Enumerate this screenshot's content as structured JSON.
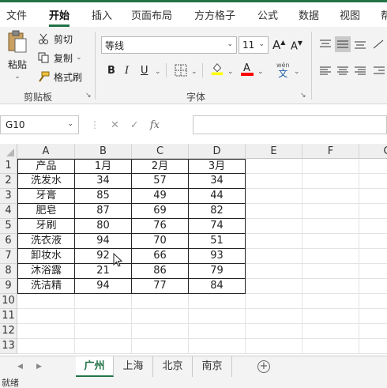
{
  "ribbon_tabs": [
    "文件",
    "开始",
    "插入",
    "页面布局",
    "方方格子",
    "公式",
    "数据",
    "视图",
    "帮"
  ],
  "clipboard": {
    "paste": "粘贴",
    "cut": "剪切",
    "copy": "复制",
    "format_painter": "格式刷",
    "group_label": "剪贴板"
  },
  "font": {
    "name": "等线",
    "size": "11",
    "grow": "A",
    "shrink": "A",
    "bold": "B",
    "italic": "I",
    "underline": "U",
    "pinyin": "wén",
    "pinyin_sub": "文",
    "group_label": "字体",
    "fill_color": "#ffff00",
    "font_color": "#ff0000"
  },
  "name_box": "G10",
  "fx_label": "fx",
  "formula": "",
  "columns": [
    "A",
    "B",
    "C",
    "D",
    "E",
    "F",
    "G"
  ],
  "rows": [
    "1",
    "2",
    "3",
    "4",
    "5",
    "6",
    "7",
    "8",
    "9",
    "10",
    "11",
    "12",
    "13"
  ],
  "table": {
    "header": [
      "产品",
      "1月",
      "2月",
      "3月"
    ],
    "body": [
      [
        "洗发水",
        "34",
        "57",
        "34"
      ],
      [
        "牙膏",
        "85",
        "49",
        "44"
      ],
      [
        "肥皂",
        "87",
        "69",
        "82"
      ],
      [
        "牙刷",
        "80",
        "76",
        "74"
      ],
      [
        "洗衣液",
        "94",
        "70",
        "51"
      ],
      [
        "卸妆水",
        "92",
        "66",
        "93"
      ],
      [
        "沐浴露",
        "21",
        "86",
        "79"
      ],
      [
        "洗洁精",
        "94",
        "77",
        "84"
      ]
    ]
  },
  "sheets": [
    "广州",
    "上海",
    "北京",
    "南京"
  ],
  "active_sheet": "广州",
  "status": "就绪",
  "accent_color": "#217346"
}
